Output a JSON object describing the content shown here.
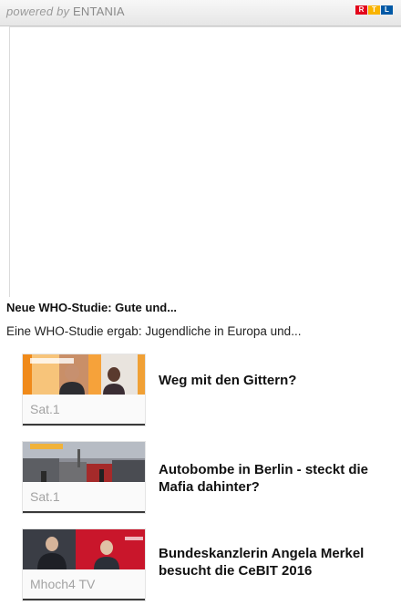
{
  "header": {
    "powered_by": "powered by",
    "brand": "ENTANIA",
    "logo_letters": [
      "R",
      "T",
      "L"
    ],
    "logo_colors": [
      "#e3051b",
      "#f9b400",
      "#0059a6"
    ]
  },
  "main": {
    "headline": "Neue WHO-Studie: Gute und...",
    "teaser": "Eine WHO-Studie ergab: Jugendliche in Europa und..."
  },
  "videos": [
    {
      "channel": "Sat.1",
      "title": "Weg mit den Gittern?"
    },
    {
      "channel": "Sat.1",
      "title": "Autobombe in Berlin - steckt die Mafia dahinter?"
    },
    {
      "channel": "Mhoch4 TV",
      "title": "Bundeskanzlerin Angela Merkel besucht die CeBIT 2016"
    }
  ]
}
